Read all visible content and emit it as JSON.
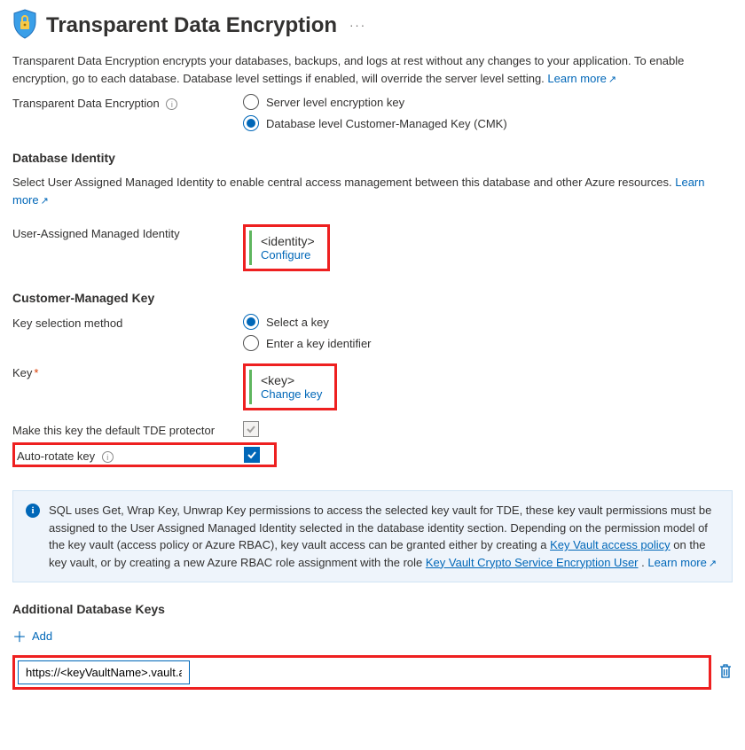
{
  "header": {
    "title": "Transparent Data Encryption"
  },
  "intro": {
    "text": "Transparent Data Encryption encrypts your databases, backups, and logs at rest without any changes to your application. To enable encryption, go to each database. Database level settings if enabled, will override the server level setting. ",
    "learn_more": "Learn more"
  },
  "tde": {
    "label": "Transparent Data Encryption",
    "opt_server": "Server level encryption key",
    "opt_db": "Database level Customer-Managed Key (CMK)"
  },
  "dbid": {
    "heading": "Database Identity",
    "desc": "Select User Assigned Managed Identity to enable central access management between this database and other Azure resources. ",
    "learn_more": "Learn more",
    "uami_label": "User-Assigned Managed Identity",
    "uami_value": "<identity>",
    "uami_action": "Configure"
  },
  "cmk": {
    "heading": "Customer-Managed Key",
    "ksm_label": "Key selection method",
    "ksm_opt_select": "Select a key",
    "ksm_opt_enter": "Enter a key identifier",
    "key_label": "Key",
    "key_value": "<key>",
    "key_action": "Change key",
    "default_label": "Make this key the default TDE protector",
    "autorotate_label": "Auto-rotate key"
  },
  "infobox": {
    "pre": "SQL uses Get, Wrap Key, Unwrap Key permissions to access the selected key vault for TDE, these key vault permissions must be assigned to the User Assigned Managed Identity selected in the database identity section. Depending on the permission model of the key vault (access policy or Azure RBAC), key vault access can be granted either by creating a ",
    "link1": "Key Vault access policy",
    "mid": " on the key vault, or by creating a new Azure RBAC role assignment with the role ",
    "link2": "Key Vault Crypto Service Encryption User",
    "post": ". ",
    "learn_more": "Learn more"
  },
  "addkeys": {
    "heading": "Additional Database Keys",
    "add_label": "Add",
    "input_value": "https://<keyVaultName>.vault.azure.net/keys/<keyName>/<keyVersionGUID>"
  }
}
